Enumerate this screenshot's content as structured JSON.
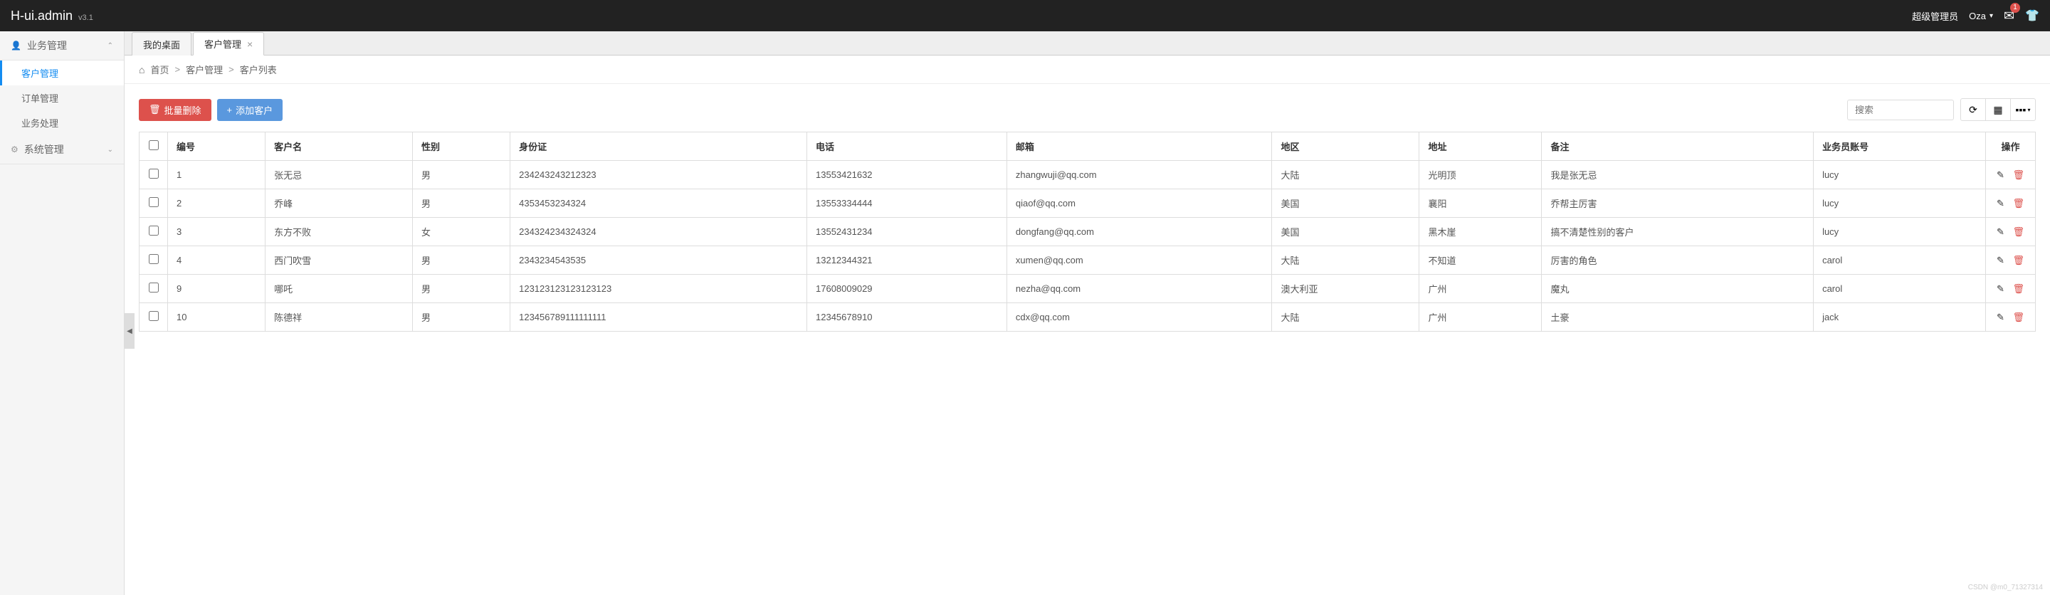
{
  "header": {
    "logo": "H-ui.admin",
    "version": "v3.1",
    "admin_label": "超级管理员",
    "username": "Oza",
    "mail_badge": "1"
  },
  "sidebar": {
    "groups": [
      {
        "label": "业务管理",
        "expanded": true,
        "items": [
          {
            "label": "客户管理",
            "active": true
          },
          {
            "label": "订单管理",
            "active": false
          },
          {
            "label": "业务处理",
            "active": false
          }
        ]
      },
      {
        "label": "系统管理",
        "expanded": false,
        "items": []
      }
    ]
  },
  "tabs": [
    {
      "label": "我的桌面",
      "active": false,
      "closable": false
    },
    {
      "label": "客户管理",
      "active": true,
      "closable": true
    }
  ],
  "breadcrumb": {
    "home": "首页",
    "part1": "客户管理",
    "part2": "客户列表"
  },
  "toolbar": {
    "delete_label": "批量删除",
    "add_label": "添加客户",
    "search_placeholder": "搜索"
  },
  "table": {
    "headers": [
      "编号",
      "客户名",
      "性别",
      "身份证",
      "电话",
      "邮箱",
      "地区",
      "地址",
      "备注",
      "业务员账号",
      "操作"
    ],
    "rows": [
      {
        "id": "1",
        "name": "张无忌",
        "gender": "男",
        "idcard": "234243243212323",
        "phone": "13553421632",
        "email": "zhangwuji@qq.com",
        "region": "大陆",
        "address": "光明顶",
        "remark": "我是张无忌",
        "agent": "lucy"
      },
      {
        "id": "2",
        "name": "乔峰",
        "gender": "男",
        "idcard": "4353453234324",
        "phone": "13553334444",
        "email": "qiaof@qq.com",
        "region": "美国",
        "address": "襄阳",
        "remark": "乔帮主厉害",
        "agent": "lucy"
      },
      {
        "id": "3",
        "name": "东方不败",
        "gender": "女",
        "idcard": "234324234324324",
        "phone": "13552431234",
        "email": "dongfang@qq.com",
        "region": "美国",
        "address": "黑木崖",
        "remark": "搞不清楚性别的客户",
        "agent": "lucy"
      },
      {
        "id": "4",
        "name": "西门吹雪",
        "gender": "男",
        "idcard": "2343234543535",
        "phone": "13212344321",
        "email": "xumen@qq.com",
        "region": "大陆",
        "address": "不知道",
        "remark": "厉害的角色",
        "agent": "carol"
      },
      {
        "id": "9",
        "name": "哪吒",
        "gender": "男",
        "idcard": "123123123123123123",
        "phone": "17608009029",
        "email": "nezha@qq.com",
        "region": "澳大利亚",
        "address": "广州",
        "remark": "魔丸",
        "agent": "carol"
      },
      {
        "id": "10",
        "name": "陈德祥",
        "gender": "男",
        "idcard": "123456789111111111",
        "phone": "12345678910",
        "email": "cdx@qq.com",
        "region": "大陆",
        "address": "广州",
        "remark": "土豪",
        "agent": "jack"
      }
    ]
  },
  "watermark": "CSDN @m0_71327314"
}
